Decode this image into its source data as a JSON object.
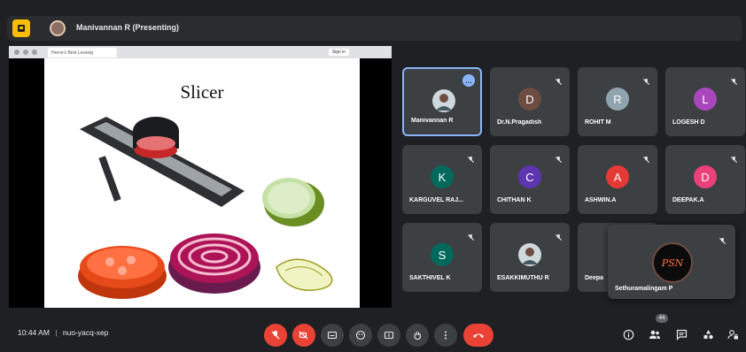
{
  "header": {
    "presenting_label": "Manivannan R (Presenting)",
    "app_badge_color": "#fbbc04"
  },
  "share": {
    "browser_tab_title": "Herne's Best Lesseig",
    "browser_signin": "Sign in",
    "slide_title": "Slicer"
  },
  "participants": [
    {
      "name": "Manivannan R",
      "initial": "",
      "color": "#5f6368",
      "active": true,
      "has_photo": true
    },
    {
      "name": "Dr.N.Pragadish",
      "initial": "D",
      "color": "#6d4c41"
    },
    {
      "name": "ROHIT M",
      "initial": "R",
      "color": "#90a4ae"
    },
    {
      "name": "LOGESH D",
      "initial": "L",
      "color": "#ab47bc"
    },
    {
      "name": "KARGUVEL RAJ...",
      "initial": "K",
      "color": "#00695c"
    },
    {
      "name": "CHITHAN K",
      "initial": "C",
      "color": "#5e35b1"
    },
    {
      "name": "ASHWIN.A",
      "initial": "A",
      "color": "#e53935"
    },
    {
      "name": "DEEPAK.A",
      "initial": "D",
      "color": "#ec407a"
    },
    {
      "name": "SAKTHIVEL K",
      "initial": "S",
      "color": "#00695c"
    },
    {
      "name": "ESAKKIMUTHU R",
      "initial": "",
      "color": "#3c4043",
      "has_photo": true
    },
    {
      "name": "Deepa",
      "initial": "",
      "color": "#3c4043"
    }
  ],
  "popup": {
    "name": "Sethuramalingam P",
    "avatar_text": "PSN"
  },
  "bottom": {
    "time": "10:44 AM",
    "separator": "|",
    "meeting_code": "nuo-yacq-xep",
    "participant_count": "44"
  }
}
